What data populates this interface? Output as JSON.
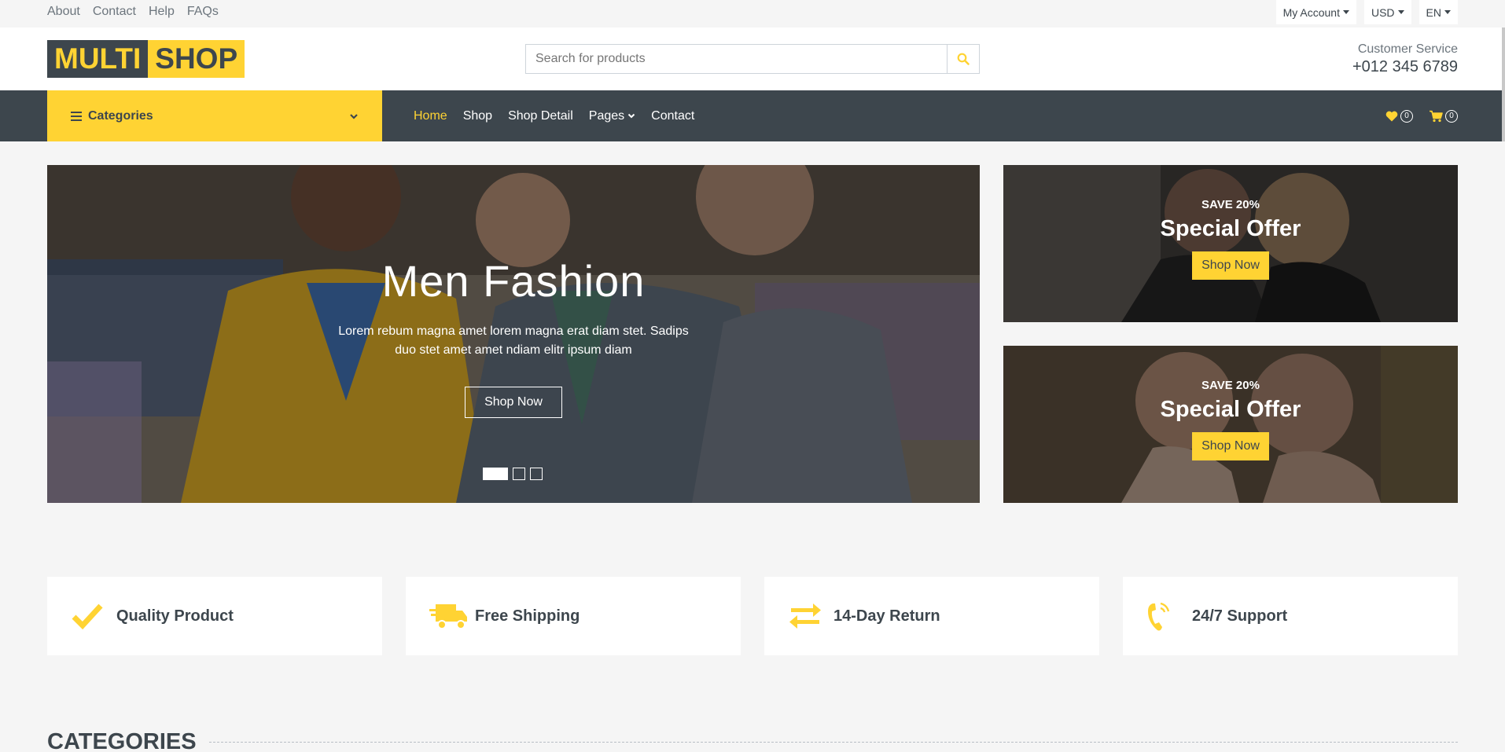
{
  "topbar": {
    "links": [
      "About",
      "Contact",
      "Help",
      "FAQs"
    ],
    "dropdowns": [
      "My Account",
      "USD",
      "EN"
    ]
  },
  "header": {
    "logo_part1": "MULTI",
    "logo_part2": "SHOP",
    "search_placeholder": "Search for products",
    "service_label": "Customer Service",
    "service_phone": "+012 345 6789"
  },
  "nav": {
    "categories_label": "Categories",
    "links": [
      "Home",
      "Shop",
      "Shop Detail",
      "Pages",
      "Contact"
    ],
    "active": "Home",
    "wishlist_count": "0",
    "cart_count": "0"
  },
  "carousel": {
    "title": "Men Fashion",
    "text": "Lorem rebum magna amet lorem magna erat diam stet. Sadips duo stet amet amet ndiam elitr ipsum diam",
    "button": "Shop Now",
    "slides": 3,
    "active_slide": 1
  },
  "offers": [
    {
      "save": "SAVE 20%",
      "title": "Special Offer",
      "button": "Shop Now"
    },
    {
      "save": "SAVE 20%",
      "title": "Special Offer",
      "button": "Shop Now"
    }
  ],
  "features": [
    {
      "icon": "check-icon",
      "label": "Quality Product"
    },
    {
      "icon": "truck-icon",
      "label": "Free Shipping"
    },
    {
      "icon": "exchange-icon",
      "label": "14-Day Return"
    },
    {
      "icon": "phone-icon",
      "label": "24/7 Support"
    }
  ],
  "categories_heading": "CATEGORIES",
  "colors": {
    "primary": "#ffd333",
    "dark": "#3d464d",
    "light_bg": "#f5f5f5"
  }
}
